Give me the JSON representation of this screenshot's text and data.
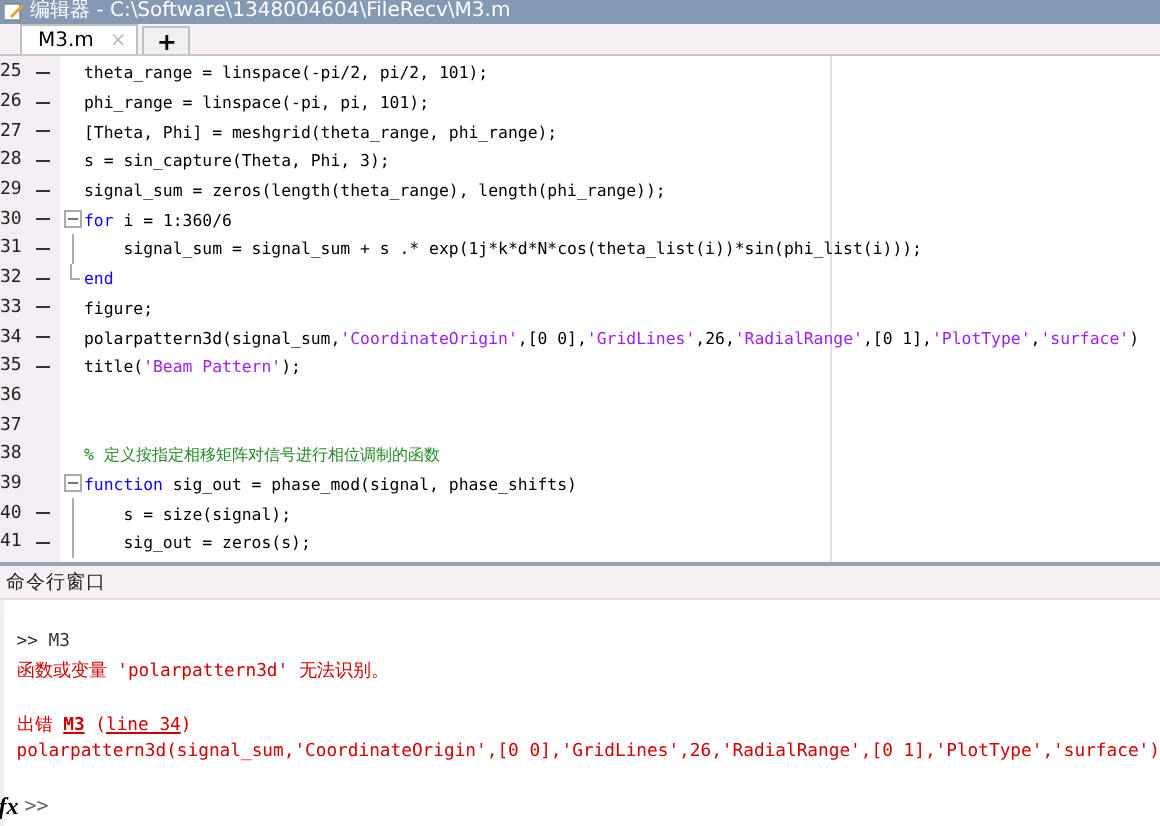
{
  "window": {
    "title": "编辑器 - C:\\Software\\1348004604\\FileRecv\\M3.m"
  },
  "tabs": [
    {
      "label": "M3.m",
      "selected": true,
      "close": "×"
    }
  ],
  "new_tab": "+",
  "editor": {
    "lines": [
      {
        "number": "25",
        "dash": true,
        "fold_box": false,
        "fold_line": false,
        "segments": [
          {
            "kind": "code",
            "text": "theta_range = linspace(-pi/2, pi/2, 101);"
          }
        ]
      },
      {
        "number": "26",
        "dash": true,
        "fold_box": false,
        "fold_line": false,
        "segments": [
          {
            "kind": "code",
            "text": "phi_range = linspace(-pi, pi, 101);"
          }
        ]
      },
      {
        "number": "27",
        "dash": true,
        "fold_box": false,
        "fold_line": false,
        "segments": [
          {
            "kind": "code",
            "text": "[Theta, Phi] = meshgrid(theta_range, phi_range);"
          }
        ]
      },
      {
        "number": "28",
        "dash": true,
        "fold_box": false,
        "fold_line": false,
        "segments": [
          {
            "kind": "code",
            "text": "s = sin_capture(Theta, Phi, 3);"
          }
        ]
      },
      {
        "number": "29",
        "dash": true,
        "fold_box": false,
        "fold_line": false,
        "segments": [
          {
            "kind": "code",
            "text": "signal_sum = zeros(length(theta_range), length(phi_range));"
          }
        ]
      },
      {
        "number": "30",
        "dash": true,
        "fold_box": true,
        "fold_line": false,
        "segments": [
          {
            "kind": "keyword",
            "text": "for"
          },
          {
            "kind": "code",
            "text": " i = 1:360/6"
          }
        ]
      },
      {
        "number": "31",
        "dash": true,
        "fold_box": false,
        "fold_line": true,
        "segments": [
          {
            "kind": "code",
            "text": "    signal_sum = signal_sum + s .* exp(1j*k*d*N*cos(theta_list(i))*sin(phi_list(i)));"
          }
        ]
      },
      {
        "number": "32",
        "dash": true,
        "fold_box": false,
        "fold_line": true,
        "segments": [
          {
            "kind": "keyword",
            "text": "end"
          }
        ]
      },
      {
        "number": "33",
        "dash": true,
        "fold_box": false,
        "fold_line": false,
        "segments": [
          {
            "kind": "code",
            "text": "figure;"
          }
        ]
      },
      {
        "number": "34",
        "dash": true,
        "fold_box": false,
        "fold_line": false,
        "segments": [
          {
            "kind": "code",
            "text": "polarpattern3d(signal_sum,"
          },
          {
            "kind": "string",
            "text": "'CoordinateOrigin'"
          },
          {
            "kind": "code",
            "text": ",[0 0],"
          },
          {
            "kind": "string",
            "text": "'GridLines'"
          },
          {
            "kind": "code",
            "text": ",26,"
          },
          {
            "kind": "string",
            "text": "'RadialRange'"
          },
          {
            "kind": "code",
            "text": ",[0 1],"
          },
          {
            "kind": "string",
            "text": "'PlotType'"
          },
          {
            "kind": "code",
            "text": ","
          },
          {
            "kind": "string",
            "text": "'surface'"
          },
          {
            "kind": "code",
            "text": ")"
          }
        ]
      },
      {
        "number": "35",
        "dash": true,
        "fold_box": false,
        "fold_line": false,
        "segments": [
          {
            "kind": "code",
            "text": "title("
          },
          {
            "kind": "string",
            "text": "'Beam Pattern'"
          },
          {
            "kind": "code",
            "text": ");"
          }
        ]
      },
      {
        "number": "36",
        "dash": false,
        "fold_box": false,
        "fold_line": false
      },
      {
        "number": "37",
        "dash": false,
        "fold_box": false,
        "fold_line": false
      },
      {
        "number": "38",
        "dash": false,
        "fold_box": false,
        "fold_line": false,
        "segments": [
          {
            "kind": "comment",
            "text": "% 定义按指定相移矩阵对信号进行相位调制的函数"
          }
        ]
      },
      {
        "number": "39",
        "dash": false,
        "fold_box": true,
        "fold_line": false,
        "segments": [
          {
            "kind": "keyword",
            "text": "function"
          },
          {
            "kind": "code",
            "text": " sig_out = phase_mod(signal, phase_shifts)"
          }
        ]
      },
      {
        "number": "40",
        "dash": true,
        "fold_box": false,
        "fold_line": true,
        "segments": [
          {
            "kind": "code",
            "text": "    s = size(signal);"
          }
        ]
      },
      {
        "number": "41",
        "dash": true,
        "fold_box": false,
        "fold_line": true,
        "segments": [
          {
            "kind": "code",
            "text": "    sig_out = zeros(s);"
          }
        ]
      }
    ]
  },
  "command_window": {
    "title": "命令行窗口",
    "blocks": [
      [
        {
          "kind": "input",
          "segments": [
            {
              "kind": "text",
              "text": ">> M3"
            }
          ]
        },
        {
          "kind": "error",
          "segments": [
            {
              "kind": "text",
              "text": "函数或变量 'polarpattern3d' 无法识别。"
            }
          ]
        }
      ],
      [
        {
          "kind": "error",
          "segments": [
            {
              "kind": "text",
              "text": "出错 "
            },
            {
              "kind": "link",
              "text": "M3"
            },
            {
              "kind": "text",
              "text": " ("
            },
            {
              "kind": "link",
              "text": "line 34"
            },
            {
              "kind": "text",
              "text": ")"
            }
          ]
        },
        {
          "kind": "error",
          "segments": [
            {
              "kind": "text",
              "text": "polarpattern3d(signal_sum,'CoordinateOrigin',[0 0],'GridLines',26,'RadialRange',[0 1],'PlotType','surface')"
            }
          ]
        }
      ]
    ],
    "prompt": {
      "icon": "fx",
      "text": ">>"
    }
  }
}
